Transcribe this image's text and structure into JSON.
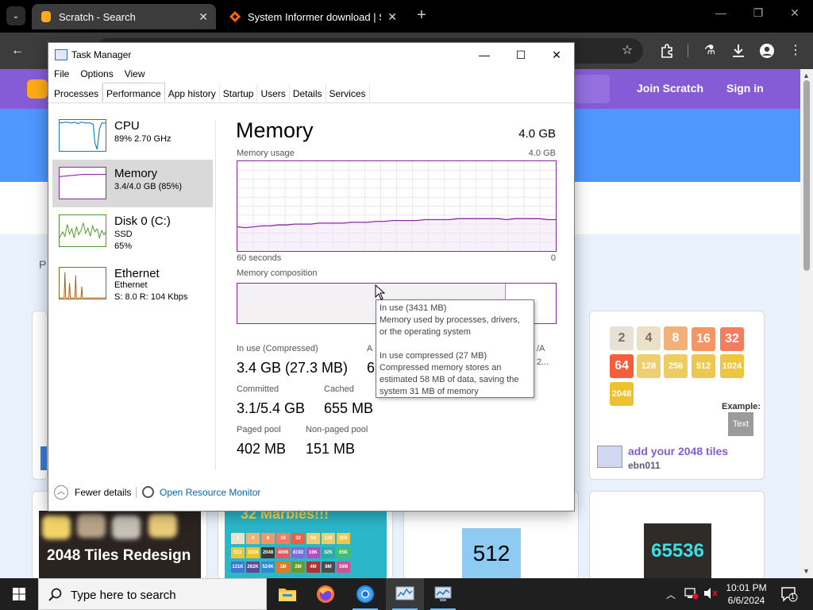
{
  "browser": {
    "tabs": [
      {
        "title": "Scratch - Search",
        "active": true
      },
      {
        "title": "System Informer download | Sc",
        "active": false
      }
    ],
    "new_tab_glyph": "+",
    "minimize_glyph": "—",
    "restore_glyph": "❐",
    "close_glyph": "✕",
    "back_glyph": "←"
  },
  "scratch": {
    "join_label": "Join Scratch",
    "signin_label": "Sign in",
    "partial_text": "P",
    "tiles": [
      {
        "label": "2",
        "color": "#e9e0d6",
        "text_color": "#776e65"
      },
      {
        "label": "4",
        "color": "#ede0c8",
        "text_color": "#776e65"
      },
      {
        "label": "8",
        "color": "#f2b179"
      },
      {
        "label": "16",
        "color": "#f59563"
      },
      {
        "label": "32",
        "color": "#f67c5f"
      },
      {
        "label": "64",
        "color": "#f65e3b"
      },
      {
        "label": "128",
        "color": "#edcf72"
      },
      {
        "label": "256",
        "color": "#edcc61"
      },
      {
        "label": "512",
        "color": "#edc850"
      },
      {
        "label": "1024",
        "color": "#edc53f"
      },
      {
        "label": "2048",
        "color": "#edc22e"
      }
    ],
    "example_label": "Example:",
    "example_text": "Text",
    "project_title": "add your 2048 tiles",
    "project_author": "ebn011",
    "thumb_2048": "2048 Tiles Redesign",
    "thumb_marbles": "32 Marbles!!!",
    "marbles_tiles": [
      "2",
      "4",
      "8",
      "16",
      "32",
      "64",
      "128",
      "256",
      "512",
      "1024",
      "2048",
      "4096",
      "8192",
      "16K",
      "32K",
      "65K",
      "131K",
      "262K",
      "524K",
      "1M",
      "2M",
      "4M",
      "8M",
      "16M"
    ],
    "thumb_512": "512",
    "thumb_65536": "65536"
  },
  "task_manager": {
    "title": "Task Manager",
    "minimize_glyph": "—",
    "maximize_glyph": "☐",
    "close_glyph": "✕",
    "menu": [
      "File",
      "Options",
      "View"
    ],
    "tabs": [
      "Processes",
      "Performance",
      "App history",
      "Startup",
      "Users",
      "Details",
      "Services"
    ],
    "active_tab": "Performance",
    "sidebar": [
      {
        "name": "CPU",
        "sub1": "89% 2.70 GHz",
        "sub2": "",
        "sub3": "",
        "color": "#1a7fc1"
      },
      {
        "name": "Memory",
        "sub1": "3.4/4.0 GB (85%)",
        "sub2": "",
        "sub3": "",
        "color": "#8b2aa8"
      },
      {
        "name": "Disk 0 (C:)",
        "sub1": "SSD",
        "sub2": "65%",
        "sub3": "",
        "color": "#4c9a2a"
      },
      {
        "name": "Ethernet",
        "sub1": "Ethernet",
        "sub2": "S: 8.0  R: 104 Kbps",
        "sub3": "",
        "color": "#a75e14"
      }
    ],
    "memory": {
      "heading": "Memory",
      "total": "4.0 GB",
      "usage_label": "Memory usage",
      "usage_max": "4.0 GB",
      "time_left": "60 seconds",
      "time_right": "0",
      "composition_label": "Memory composition",
      "usage_series": [
        0.73,
        0.74,
        0.73,
        0.72,
        0.72,
        0.71,
        0.71,
        0.7,
        0.7,
        0.7,
        0.69,
        0.69,
        0.69,
        0.69,
        0.68,
        0.68,
        0.68,
        0.67,
        0.67,
        0.66,
        0.66,
        0.66,
        0.66,
        0.65,
        0.65,
        0.65,
        0.65,
        0.64,
        0.64,
        0.64,
        0.64,
        0.64,
        0.64,
        0.65,
        0.64,
        0.64,
        0.64,
        0.64,
        0.65,
        0.65
      ],
      "stats": {
        "in_use_label": "In use (Compressed)",
        "in_use_value": "3.4 GB (27.3 MB)",
        "available_label": "A",
        "available_value": "6",
        "na_label": "/A",
        "na_value": "2...",
        "committed_label": "Committed",
        "committed_value": "3.1/5.4 GB",
        "cached_label": "Cached",
        "cached_value": "655 MB",
        "paged_label": "Paged pool",
        "paged_value": "402 MB",
        "nonpaged_label": "Non-paged pool",
        "nonpaged_value": "151 MB"
      }
    },
    "tooltip": {
      "line1": "In use (3431 MB)",
      "line2": "Memory used by processes, drivers,",
      "line3": "or the operating system",
      "line4": "In use compressed (27 MB)",
      "line5": "Compressed memory stores an",
      "line6": "estimated 58 MB of data, saving the",
      "line7": "system 31 MB of memory"
    },
    "footer": {
      "fewer_details": "Fewer details",
      "open_resource_monitor": "Open Resource Monitor"
    }
  },
  "taskbar": {
    "search_placeholder": "Type here to search",
    "time": "10:01 PM",
    "date": "6/6/2024",
    "notification_count": "1"
  }
}
